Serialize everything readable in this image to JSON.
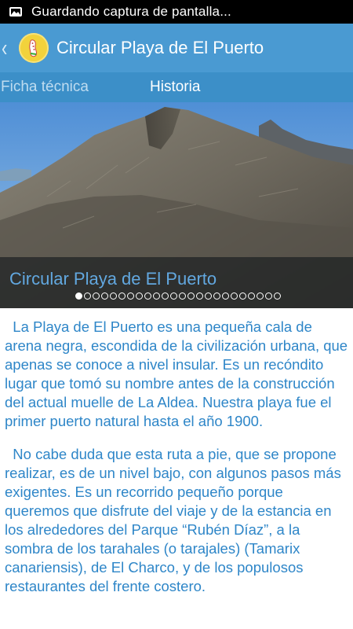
{
  "status_bar": {
    "icon": "screenshot-image-icon",
    "text": "Guardando captura de pantalla..."
  },
  "action_bar": {
    "back_icon": "chevron-left-icon",
    "logo_icon": "hiking-shoe-logo-icon",
    "title": "Circular Playa de El Puerto",
    "color": "#4a9ad2"
  },
  "tabs": [
    {
      "label": "Ficha técnica",
      "active": false
    },
    {
      "label": "Historia",
      "active": true
    }
  ],
  "hero": {
    "caption": "Circular Playa de El Puerto",
    "pager_count": 24,
    "pager_active": 0
  },
  "content": {
    "paragraphs": [
      "  La Playa de El Puerto es una pequeña cala de arena negra, escondida de la civilización urbana, que apenas se conoce a nivel insular. Es un recóndito lugar que tomó su nombre antes de la construcción del actual muelle de La Aldea. Nuestra playa fue el primer puerto natural hasta el año 1900.",
      "  No cabe duda que esta ruta a pie, que se propone realizar, es de un nivel bajo, con algunos pasos más exigentes. Es un recorrido pequeño porque queremos que disfrute del viaje y de la estancia en los alrededores del Parque “Rubén Díaz”, a la sombra de los tarahales (o tarajales) (Tamarix canariensis), de El Charco, y de los populosos restaurantes del frente costero."
    ],
    "text_color": "#2e86c8"
  }
}
